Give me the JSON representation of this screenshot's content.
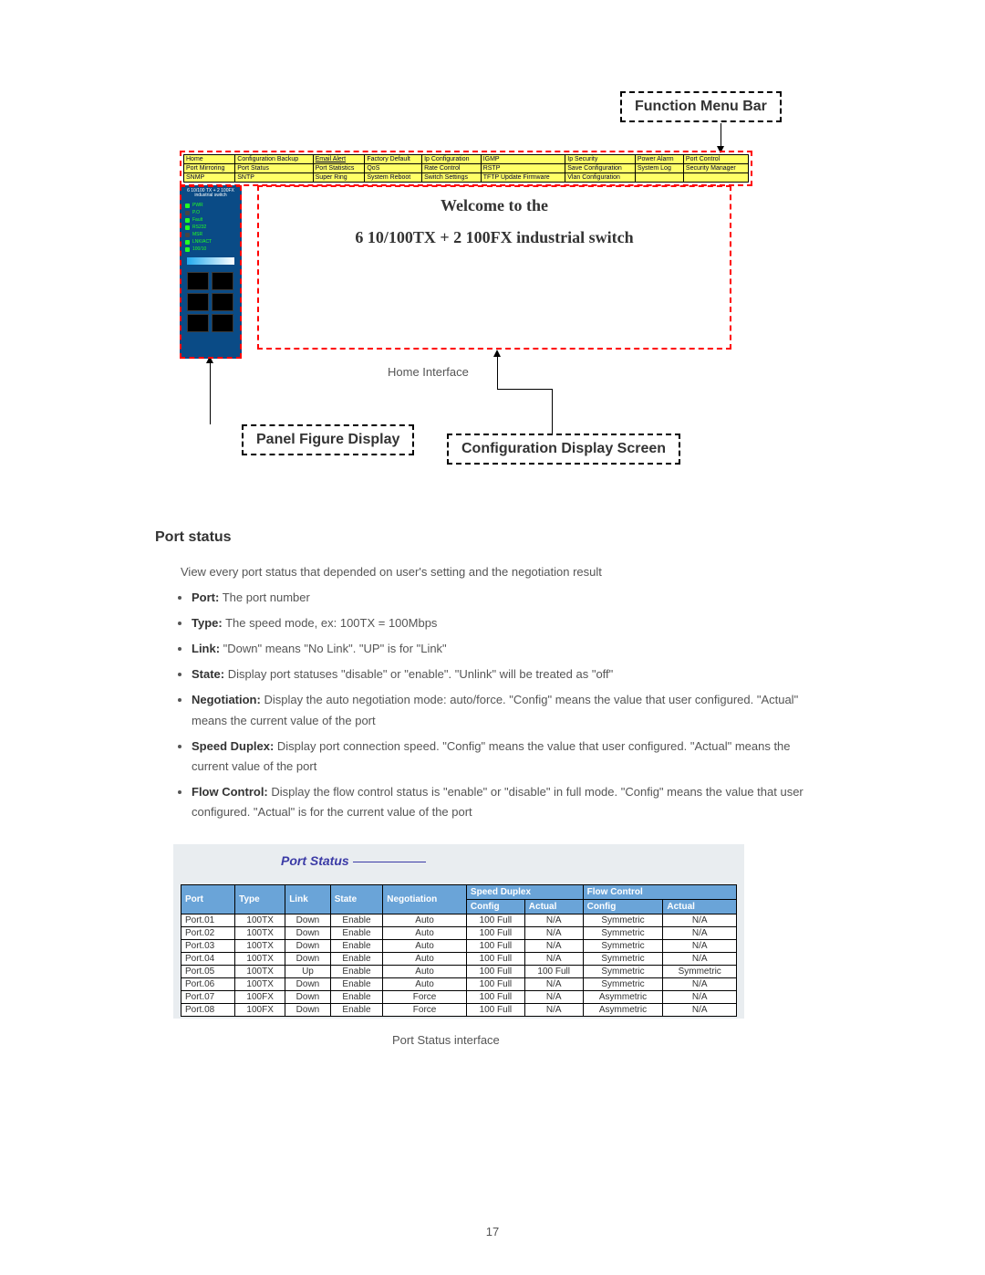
{
  "callouts": {
    "function_menu": "Function Menu Bar",
    "panel_figure": "Panel Figure Display",
    "config_screen": "Configuration Display Screen"
  },
  "captions": {
    "home": "Home Interface",
    "port_status": "Port Status interface"
  },
  "menu": {
    "rows": [
      [
        "Home",
        "Configuration Backup",
        "Email Alert",
        "Factory Default",
        "Ip Configuration",
        "IGMP",
        "Ip Security",
        "Power Alarm",
        "Port Control"
      ],
      [
        "Port Mirroring",
        "Port Status",
        "Port Statistics",
        "QoS",
        "Rate Control",
        "RSTP",
        "Save Configuration",
        "System Log",
        "Security Manager"
      ],
      [
        "SNMP",
        "SNTP",
        "Super Ring",
        "System Reboot",
        "Switch Settings",
        "TFTP Update Firmware",
        "Vlan Configuration",
        "",
        ""
      ]
    ]
  },
  "welcome": {
    "line1": "Welcome to the",
    "line2": "6 10/100TX + 2 100FX industrial switch"
  },
  "panel": {
    "top_label": "6 10/100 TX + 2 100FX industrial switch",
    "leds": [
      "PWR",
      "P.O",
      "Fault",
      "RS232",
      "MSR",
      "LNK/ACT",
      "100/10"
    ]
  },
  "section": {
    "heading": "Port status",
    "intro": "View every port status that depended on user's setting and the negotiation result",
    "bullets": [
      {
        "label": "Port:",
        "text": " The port number"
      },
      {
        "label": "Type:",
        "text": " The speed mode, ex: 100TX = 100Mbps"
      },
      {
        "label": "Link:",
        "text": " \"Down\" means \"No Link\". \"UP\" is for \"Link\""
      },
      {
        "label": "State:",
        "text": " Display port statuses \"disable\" or \"enable\". \"Unlink\" will be treated as \"off\""
      },
      {
        "label": "Negotiation:",
        "text": " Display the auto negotiation mode: auto/force. \"Config\" means the value that user configured. \"Actual\" means the current value of the port"
      },
      {
        "label": "Speed Duplex:",
        "text": " Display port connection speed. \"Config\" means the value that user configured. \"Actual\" means the current value of the port"
      },
      {
        "label": "Flow Control:",
        "text": " Display the flow control status is \"enable\" or \"disable\" in full mode. \"Config\" means the value that user configured. \"Actual\" is for the current value of the port"
      }
    ]
  },
  "port_status_table": {
    "title": "Port Status",
    "group_headers": [
      "Speed Duplex",
      "Flow Control"
    ],
    "headers": [
      "Port",
      "Type",
      "Link",
      "State",
      "Negotiation",
      "Config",
      "Actual",
      "Config",
      "Actual"
    ],
    "rows": [
      [
        "Port.01",
        "100TX",
        "Down",
        "Enable",
        "Auto",
        "100 Full",
        "N/A",
        "Symmetric",
        "N/A"
      ],
      [
        "Port.02",
        "100TX",
        "Down",
        "Enable",
        "Auto",
        "100 Full",
        "N/A",
        "Symmetric",
        "N/A"
      ],
      [
        "Port.03",
        "100TX",
        "Down",
        "Enable",
        "Auto",
        "100 Full",
        "N/A",
        "Symmetric",
        "N/A"
      ],
      [
        "Port.04",
        "100TX",
        "Down",
        "Enable",
        "Auto",
        "100 Full",
        "N/A",
        "Symmetric",
        "N/A"
      ],
      [
        "Port.05",
        "100TX",
        "Up",
        "Enable",
        "Auto",
        "100 Full",
        "100 Full",
        "Symmetric",
        "Symmetric"
      ],
      [
        "Port.06",
        "100TX",
        "Down",
        "Enable",
        "Auto",
        "100 Full",
        "N/A",
        "Symmetric",
        "N/A"
      ],
      [
        "Port.07",
        "100FX",
        "Down",
        "Enable",
        "Force",
        "100 Full",
        "N/A",
        "Asymmetric",
        "N/A"
      ],
      [
        "Port.08",
        "100FX",
        "Down",
        "Enable",
        "Force",
        "100 Full",
        "N/A",
        "Asymmetric",
        "N/A"
      ]
    ]
  },
  "page_number": "17"
}
